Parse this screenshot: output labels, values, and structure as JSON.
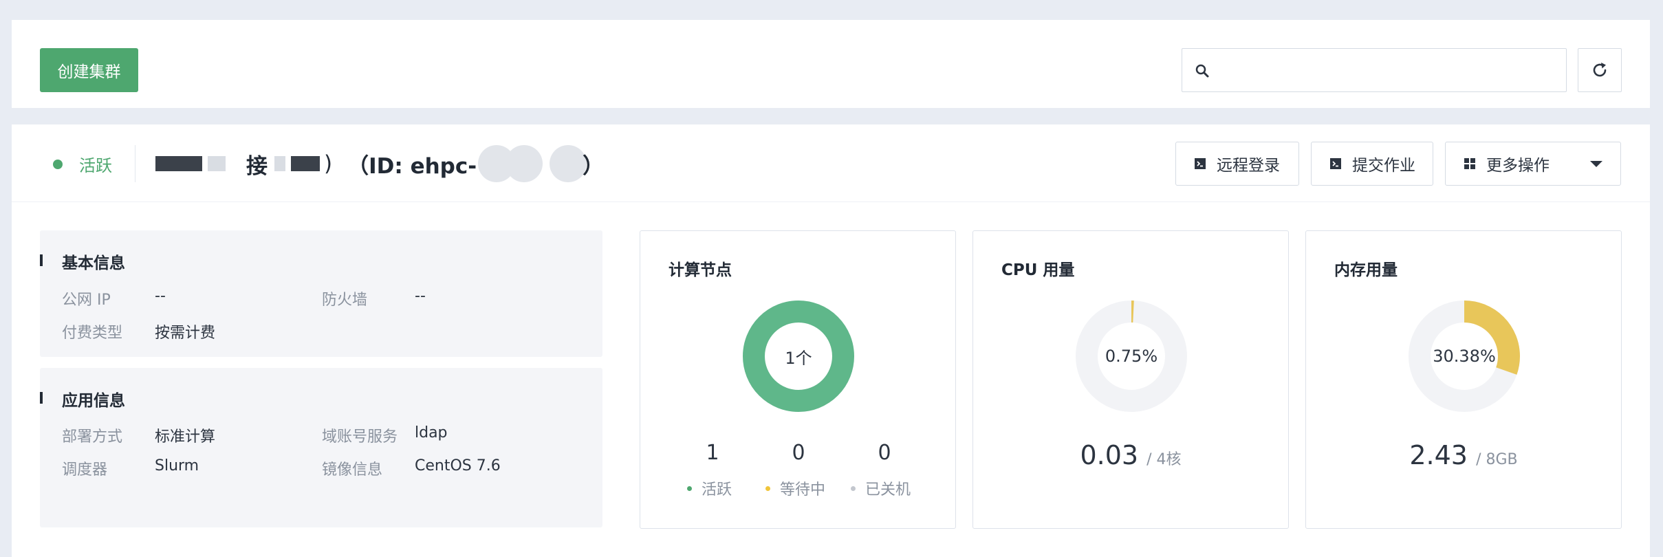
{
  "toolbar": {
    "create_label": "创建集群",
    "search_placeholder": "",
    "search_value": ""
  },
  "cluster": {
    "status": "活跃",
    "name_visible_fragment": "接",
    "id_prefix": "（ID: ehpc-",
    "id_suffix": "）",
    "actions": {
      "remote_login": "远程登录",
      "submit_job": "提交作业",
      "more_actions": "更多操作"
    }
  },
  "basic_info": {
    "title": "基本信息",
    "public_ip_label": "公网 IP",
    "public_ip_value": "--",
    "firewall_label": "防火墙",
    "firewall_value": "--",
    "billing_label": "付费类型",
    "billing_value": "按需计费"
  },
  "app_info": {
    "title": "应用信息",
    "deploy_label": "部署方式",
    "deploy_value": "标准计算",
    "domain_label": "域账号服务",
    "domain_value": "ldap",
    "scheduler_label": "调度器",
    "scheduler_value": "Slurm",
    "image_label": "镜像信息",
    "image_value": "CentOS 7.6"
  },
  "compute_nodes": {
    "title": "计算节点",
    "center": "1个",
    "active_count": "1",
    "pending_count": "0",
    "stopped_count": "0",
    "active_label": "活跃",
    "pending_label": "等待中",
    "stopped_label": "已关机",
    "active_fraction": 1.0
  },
  "cpu": {
    "title": "CPU 用量",
    "center": "0.75%",
    "value": "0.03",
    "unit": "/ 4核",
    "fraction": 0.0075
  },
  "memory": {
    "title": "内存用量",
    "center": "30.38%",
    "value": "2.43",
    "unit": "/ 8GB",
    "fraction": 0.3038
  },
  "colors": {
    "primary_green": "#4ea76f",
    "donut_green": "#5fb78a",
    "usage_yellow": "#e8c65a",
    "track_gray": "#f2f3f6",
    "pending_yellow": "#f0c53a",
    "stopped_gray": "#c3c7ce"
  },
  "icons": {
    "search": "search-icon",
    "refresh": "refresh-icon",
    "terminal": "terminal-icon",
    "grid": "grid-icon",
    "caret": "caret-down-icon"
  }
}
